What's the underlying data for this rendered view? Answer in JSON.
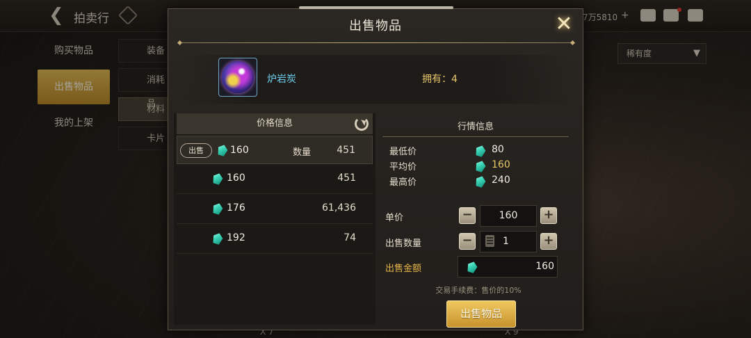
{
  "topbar": {
    "title": "拍卖行",
    "currency_text": "7万5810",
    "plus": "+"
  },
  "side_menu": {
    "items": [
      {
        "label": "购买物品"
      },
      {
        "label": "出售物品"
      },
      {
        "label": "我的上架"
      }
    ]
  },
  "sub_menu": {
    "items": [
      {
        "label": "装备"
      },
      {
        "label": "消耗品"
      },
      {
        "label": "材料"
      },
      {
        "label": "卡片"
      }
    ]
  },
  "sort": {
    "label": "稀有度",
    "caret": "▼"
  },
  "bottom_peek": {
    "left_count": "X 7",
    "right_count": "X 9"
  },
  "modal": {
    "title": "出售物品",
    "close_glyph": "✕",
    "item": {
      "name": "炉岩炭",
      "owned": "拥有：4"
    },
    "price_info": {
      "header": "价格信息",
      "sell_tag": "出售",
      "qty_label": "数量",
      "rows": [
        {
          "price": "160",
          "qty": "451"
        },
        {
          "price": "160",
          "qty": "451"
        },
        {
          "price": "176",
          "qty": "61,436"
        },
        {
          "price": "192",
          "qty": "74"
        }
      ]
    },
    "market": {
      "title": "行情信息",
      "lowest_label": "最低价",
      "lowest": "80",
      "avg_label": "平均价",
      "avg": "160",
      "highest_label": "最高价",
      "highest": "240"
    },
    "controls": {
      "unit_label": "单价",
      "unit_value": "160",
      "qty_label": "出售数量",
      "qty_value": "1",
      "total_label": "出售金额",
      "total_value": "160",
      "minus": "−",
      "plus": "+"
    },
    "fee_note": "交易手续费：售价的10%",
    "sell_button": "出售物品"
  },
  "colors": {
    "accent_gold": "#e8c66a",
    "item_name_blue": "#6fcff0",
    "gem_teal": "#3dd6b8"
  }
}
